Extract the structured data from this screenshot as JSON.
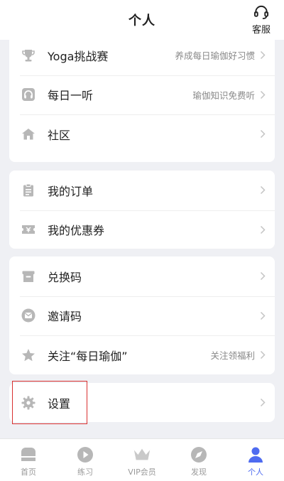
{
  "header": {
    "title": "个人",
    "service_label": "客服"
  },
  "menu": {
    "group1": [
      {
        "label": "Yoga挑战赛",
        "hint": "养成每日瑜伽好习惯"
      },
      {
        "label": "每日一听",
        "hint": "瑜伽知识免费听"
      },
      {
        "label": "社区",
        "hint": ""
      }
    ],
    "group2": [
      {
        "label": "我的订单",
        "hint": ""
      },
      {
        "label": "我的优惠券",
        "hint": ""
      }
    ],
    "group3": [
      {
        "label": "兑换码",
        "hint": ""
      },
      {
        "label": "邀请码",
        "hint": ""
      },
      {
        "label": "关注“每日瑜伽”",
        "hint": "关注领福利"
      }
    ],
    "group4": [
      {
        "label": "设置",
        "hint": ""
      }
    ]
  },
  "tabs": [
    {
      "label": "首页",
      "icon": "home-icon",
      "active": false
    },
    {
      "label": "练习",
      "icon": "play-icon",
      "active": false
    },
    {
      "label": "VIP会员",
      "icon": "crown-icon",
      "active": false
    },
    {
      "label": "发现",
      "icon": "compass-icon",
      "active": false
    },
    {
      "label": "个人",
      "icon": "person-icon",
      "active": true
    }
  ],
  "colors": {
    "accent": "#4e6bf0",
    "icon_gray": "#b7b7b7",
    "highlight_box": "#d9302f",
    "background": "#eff0f4"
  }
}
